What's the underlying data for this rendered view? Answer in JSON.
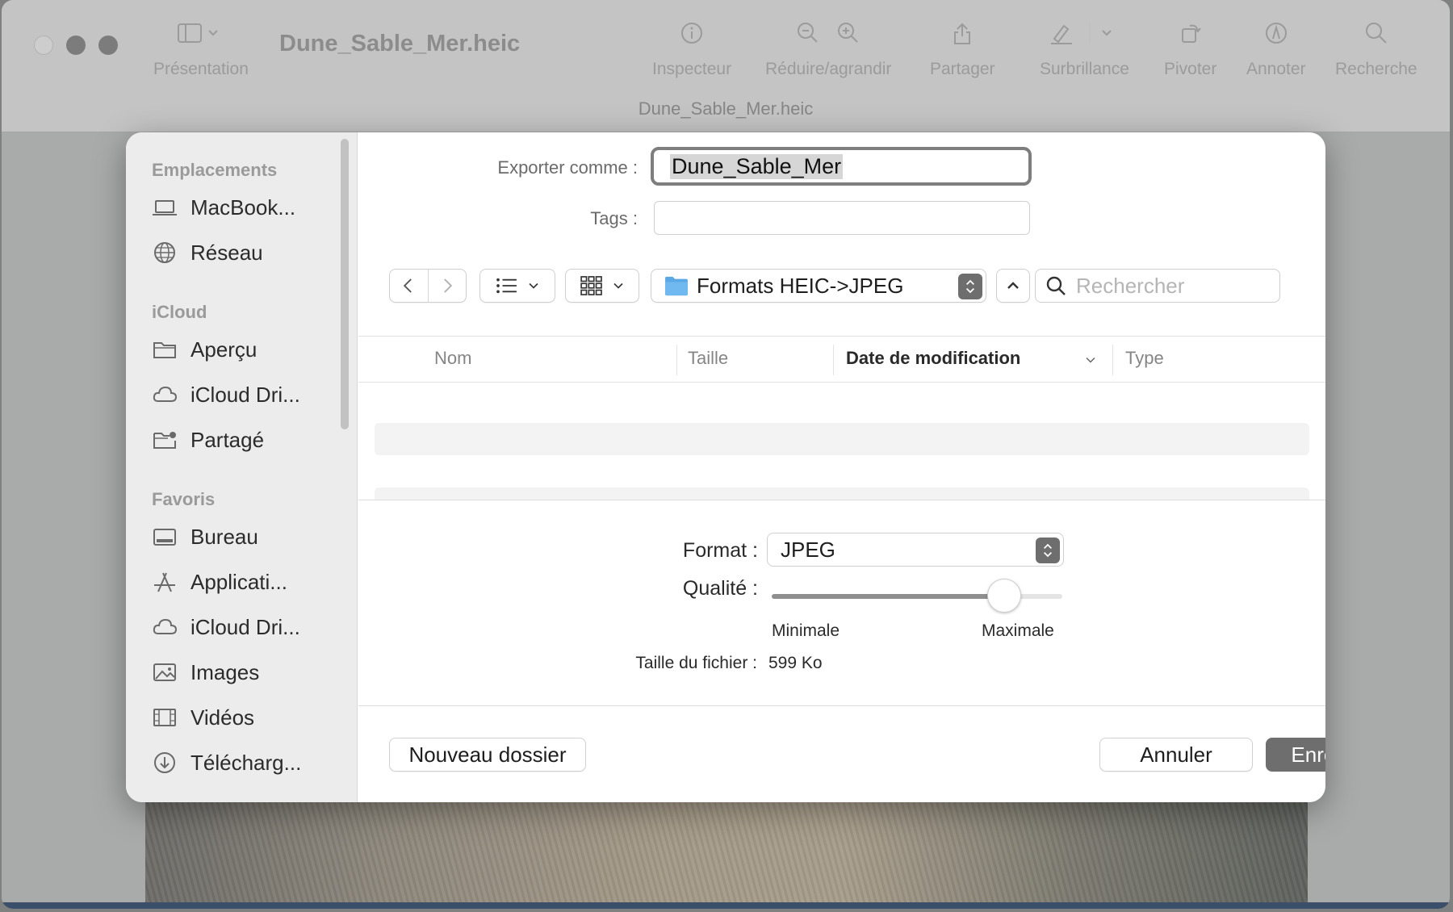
{
  "window": {
    "title": "Dune_Sable_Mer.heic",
    "subtitle": "Dune_Sable_Mer.heic",
    "toolbar": {
      "presentation": "Présentation",
      "inspector": "Inspecteur",
      "zoom": "Réduire/agrandir",
      "share": "Partager",
      "highlight": "Surbrillance",
      "rotate": "Pivoter",
      "annotate": "Annoter",
      "search": "Recherche"
    }
  },
  "sidebar": {
    "sections": [
      {
        "title": "Emplacements",
        "items": [
          {
            "label": "MacBook...",
            "icon": "laptop-icon"
          },
          {
            "label": "Réseau",
            "icon": "globe-icon"
          }
        ]
      },
      {
        "title": "iCloud",
        "items": [
          {
            "label": "Aperçu",
            "icon": "folder-icon"
          },
          {
            "label": "iCloud Dri...",
            "icon": "cloud-icon"
          },
          {
            "label": "Partagé",
            "icon": "shared-folder-icon"
          }
        ]
      },
      {
        "title": "Favoris",
        "items": [
          {
            "label": "Bureau",
            "icon": "desktop-icon"
          },
          {
            "label": "Applicati...",
            "icon": "applications-icon"
          },
          {
            "label": "iCloud Dri...",
            "icon": "cloud-icon"
          },
          {
            "label": "Images",
            "icon": "photo-icon"
          },
          {
            "label": "Vidéos",
            "icon": "film-icon"
          },
          {
            "label": "Télécharg...",
            "icon": "download-icon"
          }
        ]
      }
    ]
  },
  "export": {
    "export_as_label": "Exporter comme :",
    "filename": "Dune_Sable_Mer",
    "tags_label": "Tags :",
    "tags_value": ""
  },
  "browser": {
    "location": "Formats HEIC->JPEG",
    "search_placeholder": "Rechercher",
    "columns": {
      "name": "Nom",
      "size": "Taille",
      "modified": "Date de modification",
      "type": "Type"
    }
  },
  "options": {
    "format_label": "Format :",
    "format_value": "JPEG",
    "quality_label": "Qualité :",
    "quality_level": 0.8,
    "quality_min": "Minimale",
    "quality_max": "Maximale",
    "filesize_label": "Taille du fichier :",
    "filesize_value": "599 Ko"
  },
  "buttons": {
    "new_folder": "Nouveau dossier",
    "cancel": "Annuler",
    "save": "Enregistrer"
  }
}
